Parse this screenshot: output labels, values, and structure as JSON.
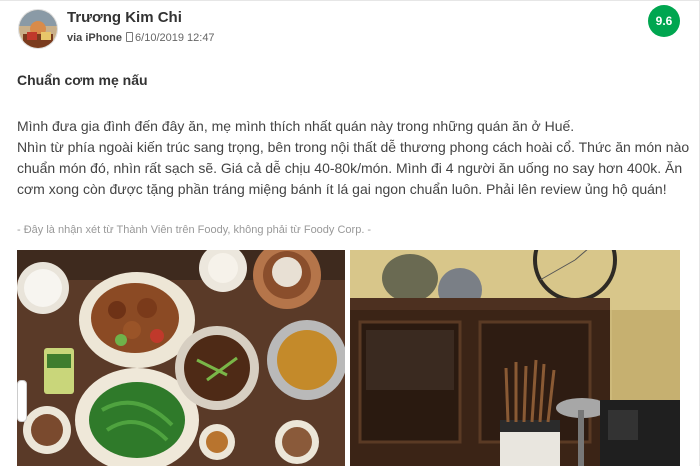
{
  "review": {
    "author": "Trương Kim Chi",
    "device": "via iPhone",
    "date": "6/10/2019 12:47",
    "score": "9.6",
    "title": "Chuẩn cơm mẹ nấu",
    "paragraph_1": "Mình đưa gia đình đến đây ăn, mẹ mình thích nhất quán này trong những quán ăn ở Huế.",
    "paragraph_2": "Nhìn từ phía ngoài kiến trúc sang trọng, bên trong nội thất dễ thương phong cách hoài cổ. Thức ăn món nào chuẩn món đó, nhìn rất sạch sẽ. Giá cả dễ chịu 40-80k/món. Mình đi 4 người ăn uống no say hơn 400k. Ăn cơm xong còn được tặng phần tráng miệng bánh ít lá gai ngon chuẩn luôn. Phải lên review ủng hộ quán!",
    "disclaimer": "- Đây là nhận xét từ Thành Viên trên Foody, không phải từ Foody Corp. -"
  },
  "icons": {
    "avatar": "user-avatar",
    "device": "phone-icon"
  },
  "colors": {
    "score_badge": "#00a650",
    "text": "#444444",
    "muted": "#999999"
  },
  "images": [
    "food-dishes-photo",
    "restaurant-interior-photo"
  ]
}
